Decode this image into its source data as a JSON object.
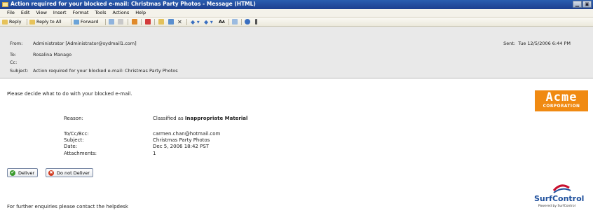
{
  "window": {
    "title": "Action required for your blocked e-mail: Christmas Party Photos - Message (HTML)",
    "controls": [
      "▁",
      "▣"
    ]
  },
  "menubar": [
    "File",
    "Edit",
    "View",
    "Insert",
    "Format",
    "Tools",
    "Actions",
    "Help"
  ],
  "toolbar": {
    "reply": "Reply",
    "reply_all": "Reply to All",
    "forward": "Forward",
    "font_size_symbol": "A"
  },
  "header": {
    "from_label": "From:",
    "from_value": "Administrator [Administrator@sydmail1.com]",
    "to_label": "To:",
    "to_value": "Rosalina Manago",
    "cc_label": "Cc:",
    "cc_value": "",
    "subject_label": "Subject:",
    "subject_value": "Action required for your blocked e-mail: Christmas Party Photos",
    "sent_label": "Sent:",
    "sent_value": "Tue 12/5/2006 6:44 PM"
  },
  "body": {
    "intro": "Please decide what to do with your blocked e-mail.",
    "reason_label": "Reason:",
    "reason_prefix": "Classified as",
    "reason_value": "Inappropriate Material",
    "details": [
      {
        "label": "To/Cc/Bcc:",
        "value": "carmen.chan@hotmail.com"
      },
      {
        "label": "Subject:",
        "value": "Christmas Party Photos"
      },
      {
        "label": "Date:",
        "value": "Dec 5, 2006 18:42 PST"
      },
      {
        "label": "Attachments:",
        "value": "1"
      }
    ],
    "deliver_button": "Deliver",
    "do_not_deliver_button": "Do not Deliver",
    "footer": "For further enquiries please contact the helpdesk"
  },
  "logos": {
    "acme_main": "Acme",
    "acme_sub": "CORPORATION",
    "surfcontrol_name": "SurfControl",
    "surfcontrol_tag": "Powered by SurfControl"
  },
  "colors": {
    "titlebar": "#1c3f8f",
    "acme_orange": "#f08a12",
    "surfcontrol_blue": "#1e4f9c",
    "surfcontrol_red": "#c8102e",
    "deliver_green": "#3a9a2c",
    "reject_red": "#d13a1f"
  }
}
